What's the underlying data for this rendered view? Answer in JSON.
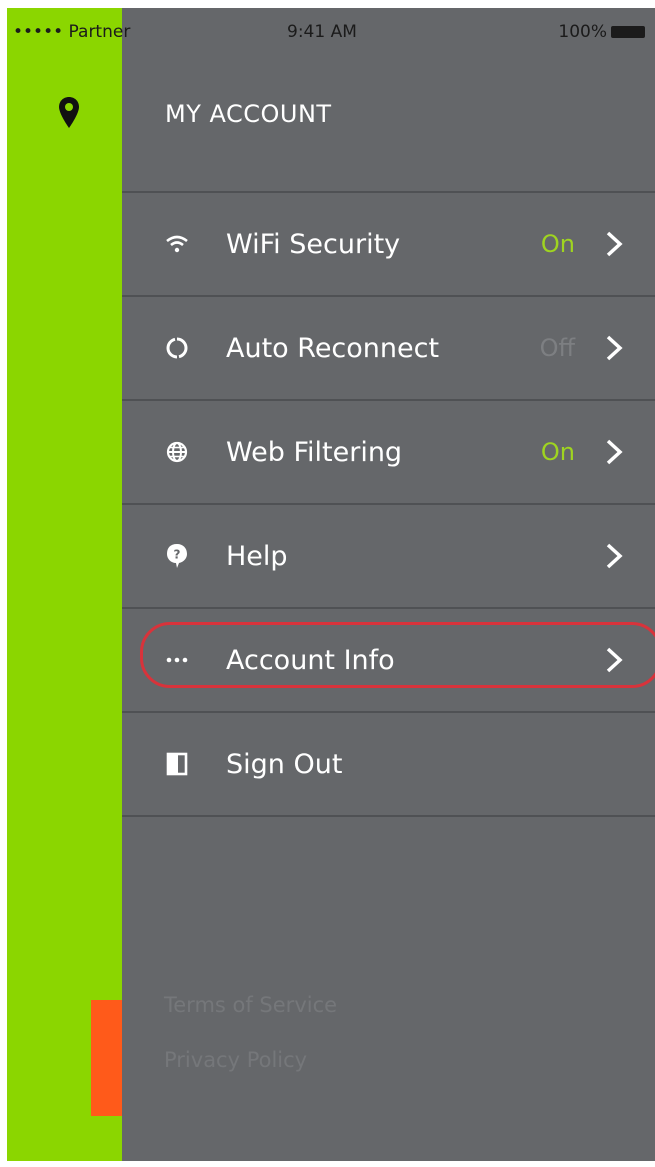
{
  "status_bar": {
    "carrier": "••••• Partner",
    "time": "9:41 AM",
    "battery": "100%"
  },
  "header": {
    "title": "MY ACCOUNT"
  },
  "menu": [
    {
      "label": "WiFi Security",
      "value": "On",
      "icon": "wifi-icon"
    },
    {
      "label": "Auto Reconnect",
      "value": "Off",
      "icon": "reconnect-icon"
    },
    {
      "label": "Web Filtering",
      "value": "On",
      "icon": "globe-icon"
    },
    {
      "label": "Help",
      "value": "",
      "icon": "help-icon"
    },
    {
      "label": "Account Info",
      "value": "",
      "icon": "more-dots-icon"
    },
    {
      "label": "Sign Out",
      "value": "",
      "icon": "sign-out-icon"
    }
  ],
  "footer": {
    "terms": "Terms of Service",
    "privacy": "Privacy Policy",
    "copyright": ""
  },
  "colors": {
    "green": "#8bd600",
    "panel": "#65676a",
    "on": "#9fd420",
    "highlight": "#d8333b",
    "orange": "#ff5a1a"
  }
}
